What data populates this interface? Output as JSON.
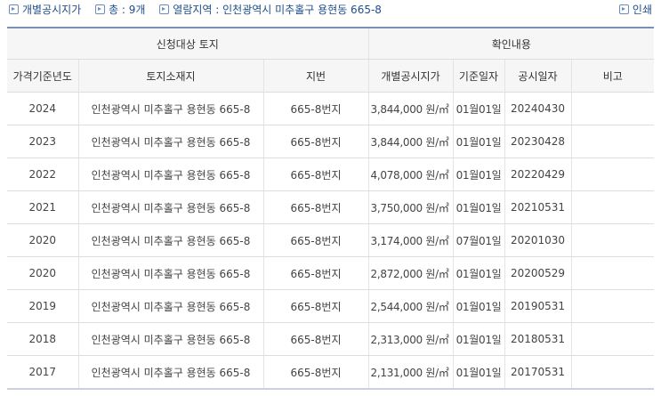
{
  "topbar": {
    "individual_price": "개별공시지가",
    "total": "총 : 9개",
    "area": "열람지역 : 인천광역시 미추홀구 용현동 665-8",
    "print": "인쇄"
  },
  "table": {
    "group_headers": [
      "신청대상 토지",
      "확인내용"
    ],
    "columns": [
      "가격기준년도",
      "토지소재지",
      "지번",
      "개별공시지가",
      "기준일자",
      "공시일자",
      "비고"
    ],
    "rows": [
      [
        "2024",
        "인천광역시 미추홀구 용현동 665-8",
        "665-8번지",
        "3,844,000 원/㎡",
        "01월01일",
        "20240430",
        ""
      ],
      [
        "2023",
        "인천광역시 미추홀구 용현동 665-8",
        "665-8번지",
        "3,844,000 원/㎡",
        "01월01일",
        "20230428",
        ""
      ],
      [
        "2022",
        "인천광역시 미추홀구 용현동 665-8",
        "665-8번지",
        "4,078,000 원/㎡",
        "01월01일",
        "20220429",
        ""
      ],
      [
        "2021",
        "인천광역시 미추홀구 용현동 665-8",
        "665-8번지",
        "3,750,000 원/㎡",
        "01월01일",
        "20210531",
        ""
      ],
      [
        "2020",
        "인천광역시 미추홀구 용현동 665-8",
        "665-8번지",
        "3,174,000 원/㎡",
        "07월01일",
        "20201030",
        ""
      ],
      [
        "2020",
        "인천광역시 미추홀구 용현동 665-8",
        "665-8번지",
        "2,872,000 원/㎡",
        "01월01일",
        "20200529",
        ""
      ],
      [
        "2019",
        "인천광역시 미추홀구 용현동 665-8",
        "665-8번지",
        "2,544,000 원/㎡",
        "01월01일",
        "20190531",
        ""
      ],
      [
        "2018",
        "인천광역시 미추홀구 용현동 665-8",
        "665-8번지",
        "2,313,000 원/㎡",
        "01월01일",
        "20180531",
        ""
      ],
      [
        "2017",
        "인천광역시 미추홀구 용현동 665-8",
        "665-8번지",
        "2,131,000 원/㎡",
        "01월01일",
        "20170531",
        ""
      ]
    ]
  }
}
